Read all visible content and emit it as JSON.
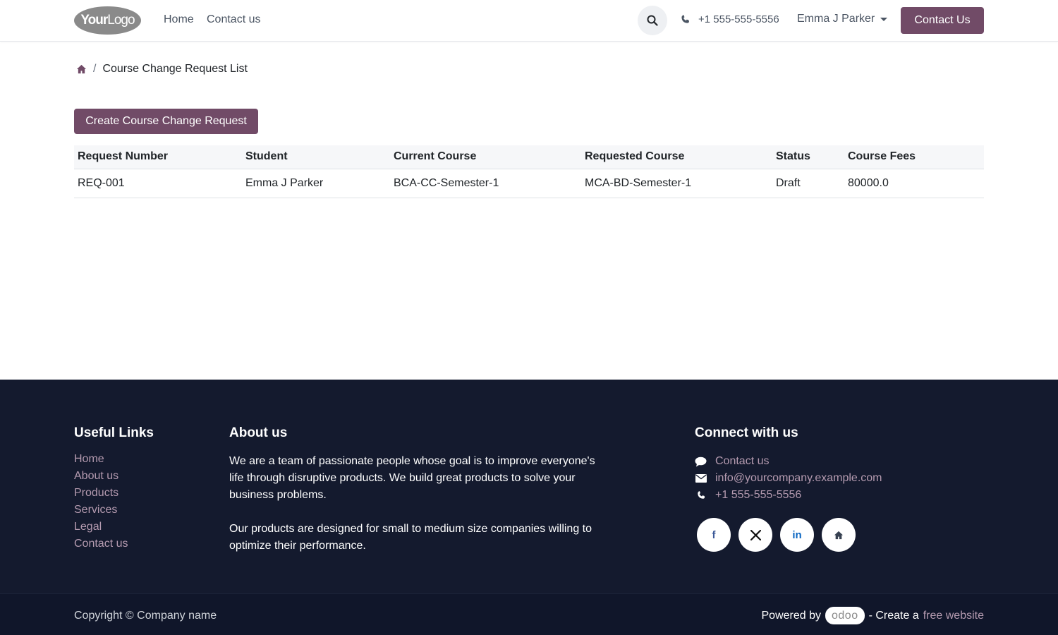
{
  "header": {
    "logo": {
      "bold": "Your",
      "rest": "Logo"
    },
    "nav": [
      {
        "label": "Home"
      },
      {
        "label": "Contact us"
      }
    ],
    "phone": "+1 555-555-5556",
    "user": "Emma J Parker",
    "cta_label": "Contact Us"
  },
  "breadcrumb": {
    "current": "Course Change Request List"
  },
  "main": {
    "create_label": "Create Course Change Request",
    "table": {
      "columns": [
        "Request Number",
        "Student",
        "Current Course",
        "Requested Course",
        "Status",
        "Course Fees"
      ],
      "rows": [
        {
          "request_number": "REQ-001",
          "student": "Emma J Parker",
          "current_course": "BCA-CC-Semester-1",
          "requested_course": "MCA-BD-Semester-1",
          "status": "Draft",
          "fees": "80000.0"
        }
      ]
    }
  },
  "footer": {
    "useful_links": {
      "title": "Useful Links",
      "items": [
        "Home",
        "About us",
        "Products",
        "Services",
        "Legal",
        "Contact us"
      ]
    },
    "about": {
      "title": "About us",
      "p1": "We are a team of passionate people whose goal is to improve everyone's life through disruptive products. We build great products to solve your business problems.",
      "p2": "Our products are designed for small to medium size companies willing to optimize their performance."
    },
    "connect": {
      "title": "Connect with us",
      "contact": "Contact us",
      "email": "info@yourcompany.example.com",
      "phone": "+1 555-555-5556",
      "socials": [
        "facebook-icon",
        "x-icon",
        "linkedin-icon",
        "home-icon"
      ]
    },
    "copyright": "Copyright © Company name",
    "powered_by": "Powered by",
    "odoo": "odoo",
    "create_a": "- Create a",
    "free_website": "free website"
  },
  "colors": {
    "brand": "#714b67",
    "footer_bg": "#141a2e",
    "link_muted": "#b59bb0"
  }
}
